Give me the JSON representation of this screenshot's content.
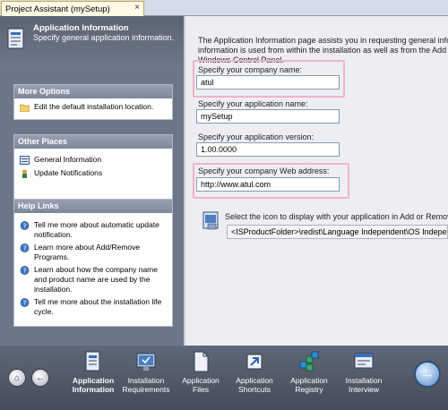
{
  "tab": {
    "title": "Project Assistant (mySetup)",
    "close": "×"
  },
  "header": {
    "title": "Application Information",
    "subtitle": "Specify general application information."
  },
  "more_options": {
    "title": "More Options",
    "items": [
      {
        "label": "Edit the default installation location."
      }
    ]
  },
  "other_places": {
    "title": "Other Places",
    "items": [
      {
        "label": "General Information"
      },
      {
        "label": "Update Notifications"
      }
    ]
  },
  "help_links": {
    "title": "Help Links",
    "items": [
      {
        "line1": "Tell me more about automatic update",
        "line2": "notification."
      },
      {
        "line1": "Learn more about Add/Remove",
        "line2": "Programs."
      },
      {
        "line1": "Learn about how the company name",
        "line2": "and product name are used by the",
        "line3": "installation."
      },
      {
        "line1": "Tell me more about the installation life",
        "line2": "cycle."
      }
    ]
  },
  "main": {
    "intro_line1": "The Application Information page assists you in requesting general infor",
    "intro_line2": "information is used from within the installation as well as from the Add o",
    "intro_line3": "Windows Control Panel.",
    "company_label": "Specify your company name:",
    "company_value": "atul",
    "app_name_label": "Specify your application name:",
    "app_name_value": "mySetup",
    "version_label": "Specify your application version:",
    "version_value": "1.00.0000",
    "web_label": "Specify your company Web address:",
    "web_value": "http://www.atul.com",
    "icon_label": "Select the icon to display with your application in Add or Remove",
    "icon_path": "<ISProductFolder>\\redist\\Language Independent\\OS Indepen"
  },
  "nav": {
    "home": "⌂",
    "back": "←",
    "next": "→",
    "items": [
      {
        "line1": "Application",
        "line2": "Information"
      },
      {
        "line1": "Installation",
        "line2": "Requirements"
      },
      {
        "line1": "Application",
        "line2": "Files"
      },
      {
        "line1": "Application",
        "line2": "Shortcuts"
      },
      {
        "line1": "Application",
        "line2": "Registry"
      },
      {
        "line1": "Installation",
        "line2": "Interview"
      }
    ]
  },
  "colors": {
    "highlight": "#f2b3c8",
    "pane_bg": "#6d7687",
    "nav_bg": "#4f5764"
  }
}
